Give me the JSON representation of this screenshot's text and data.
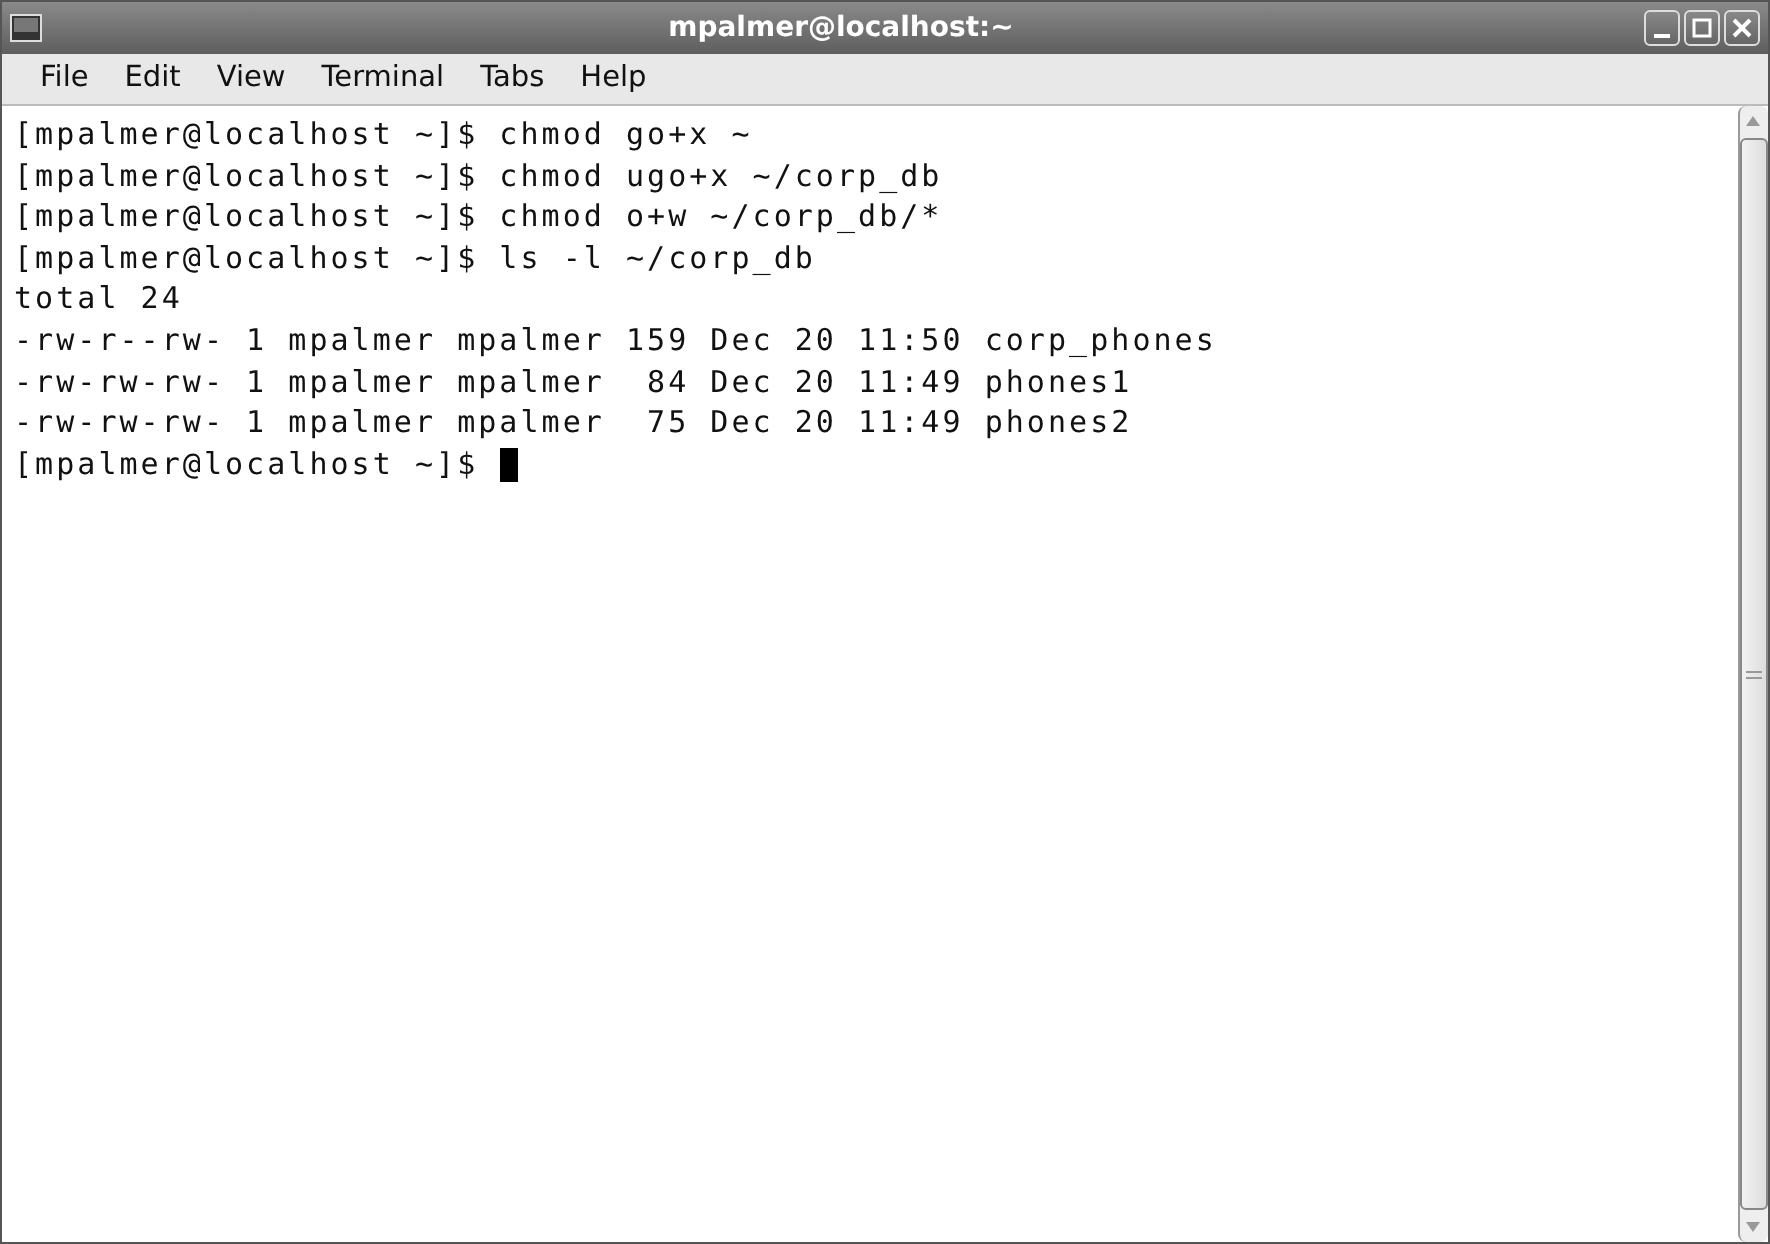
{
  "window": {
    "title": "mpalmer@localhost:~"
  },
  "menu": [
    "File",
    "Edit",
    "View",
    "Terminal",
    "Tabs",
    "Help"
  ],
  "terminal": {
    "lines": [
      {
        "text": "[mpalmer@localhost ~]$ chmod go+x ~",
        "cursor": false
      },
      {
        "text": "[mpalmer@localhost ~]$ chmod ugo+x ~/corp_db",
        "cursor": false
      },
      {
        "text": "[mpalmer@localhost ~]$ chmod o+w ~/corp_db/*",
        "cursor": false
      },
      {
        "text": "[mpalmer@localhost ~]$ ls -l ~/corp_db",
        "cursor": false
      },
      {
        "text": "total 24",
        "cursor": false
      },
      {
        "text": "-rw-r--rw- 1 mpalmer mpalmer 159 Dec 20 11:50 corp_phones",
        "cursor": false
      },
      {
        "text": "-rw-rw-rw- 1 mpalmer mpalmer  84 Dec 20 11:49 phones1",
        "cursor": false
      },
      {
        "text": "-rw-rw-rw- 1 mpalmer mpalmer  75 Dec 20 11:49 phones2",
        "cursor": false
      },
      {
        "text": "[mpalmer@localhost ~]$ ",
        "cursor": true
      }
    ]
  }
}
